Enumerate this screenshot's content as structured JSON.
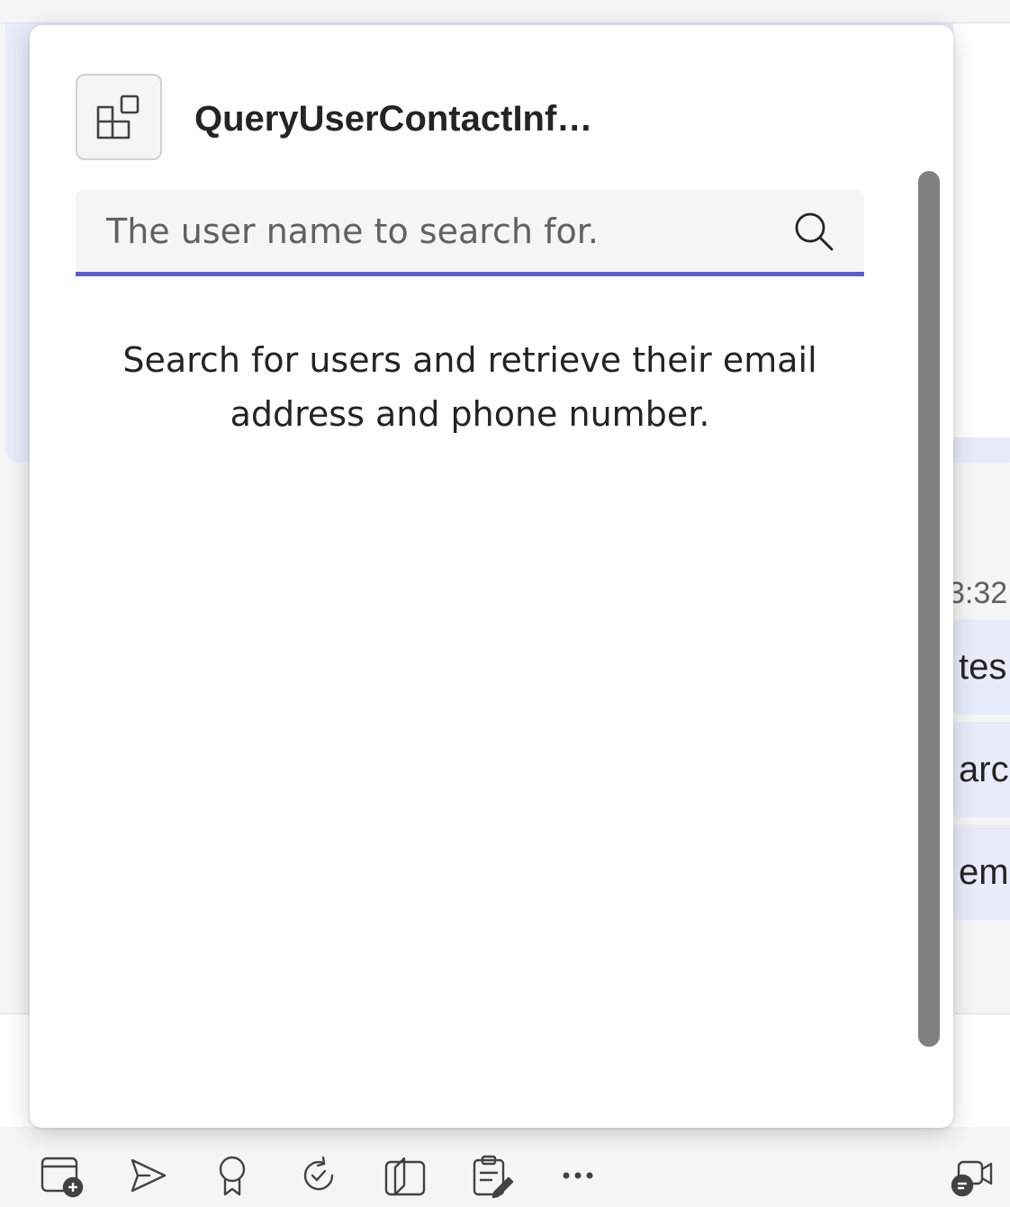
{
  "dialog": {
    "app_icon": "apps-add-icon",
    "title": "QueryUserContactInf…",
    "search": {
      "placeholder": "The user name to search for.",
      "value": "",
      "icon": "search-icon"
    },
    "description": "Search for users and retrieve their email address and phone number."
  },
  "background_chat": {
    "timestamp": "3:32",
    "bubbles": [
      "tes",
      "arch",
      "emo"
    ]
  },
  "toolbar": {
    "icons": [
      "schedule-meeting-icon",
      "send-forward-icon",
      "praise-badge-icon",
      "loop-icon",
      "copilot-notebook-icon",
      "forms-icon",
      "more-options-icon",
      "meet-now-icon"
    ]
  },
  "colors": {
    "accent": "#5b5fc7",
    "bubble_bg": "#e8ebfa",
    "scrollbar": "#808080"
  }
}
